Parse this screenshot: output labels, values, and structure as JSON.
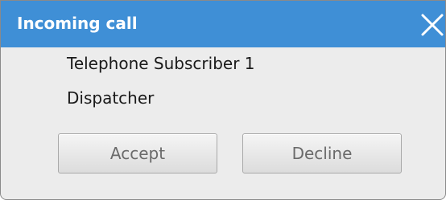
{
  "dialog": {
    "title": "Incoming call",
    "caller_name": "Telephone Subscriber 1",
    "caller_role": "Dispatcher",
    "accept_label": "Accept",
    "decline_label": "Decline"
  },
  "colors": {
    "titlebar": "#3f8fd6",
    "dialog_background": "#ececec",
    "button_text": "#6a6a6a"
  },
  "icons": {
    "close": "close-icon"
  }
}
